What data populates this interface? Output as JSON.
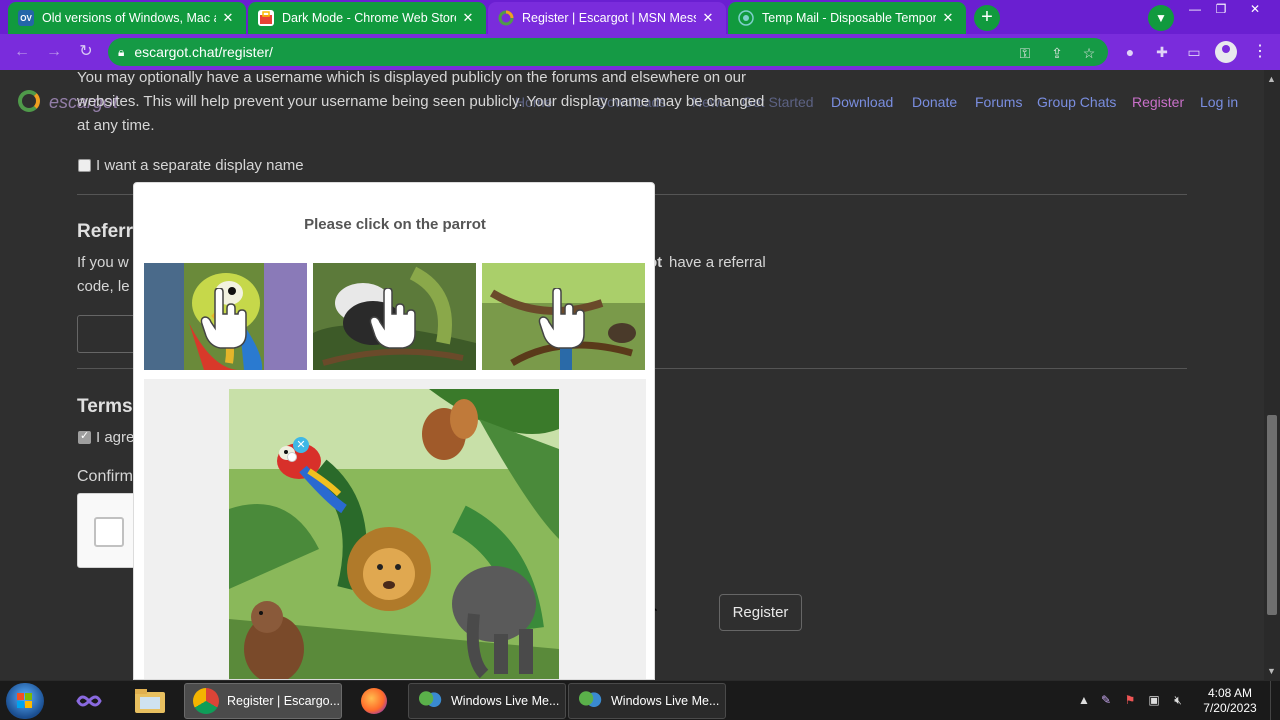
{
  "browser": {
    "tabs": [
      {
        "title": "Old versions of Windows, Mac and Linux software",
        "favicon": "OV",
        "favicon_color": "#2466a8"
      },
      {
        "title": "Dark Mode - Chrome Web Store",
        "favicon": "",
        "favicon_color": "#e94235"
      },
      {
        "title": "Register | Escargot | MSN Messenger",
        "favicon": "",
        "favicon_color": "#f0a020"
      },
      {
        "title": "Temp Mail - Disposable Temporary Email",
        "favicon": "",
        "favicon_color": "#2aa5a0"
      }
    ],
    "new_tab_label": "+",
    "url": "escargot.chat/register/"
  },
  "site": {
    "logo_text": "escargot",
    "nav": {
      "download": "Download",
      "donate": "Donate",
      "forums": "Forums",
      "group_chats": "Group Chats",
      "register": "Register",
      "login": "Log in",
      "ghost_items": [
        "Home",
        "Downloads",
        "News",
        "Get Started"
      ]
    }
  },
  "form": {
    "display_name_text_1": "You may optionally have a username which is displayed publicly on the forums and elsewhere on our",
    "display_name_text_2": "websites. This will help prevent your username being seen publicly. Your display name may be changed",
    "display_name_text_3": "at any time.",
    "separate_display_name_label": "I want a separate display name",
    "referral_heading": "Referr",
    "referral_text_1_left": "If you w",
    "referral_text_1_bold": "ot",
    "referral_text_1_right": "have a referral",
    "referral_text_2": "code, le",
    "terms_heading": "Terms",
    "agree_label": "I agre",
    "confirm_heading": "Confirm",
    "register_button": "Register"
  },
  "captcha": {
    "prompt": "Please click on the parrot"
  },
  "taskbar": {
    "apps": [
      {
        "label": "Register | Escargo...",
        "active": true
      },
      {
        "label": "Windows Live Me...",
        "active": false
      },
      {
        "label": "Windows Live Me...",
        "active": false
      }
    ],
    "time": "4:08 AM",
    "date": "7/20/2023"
  }
}
